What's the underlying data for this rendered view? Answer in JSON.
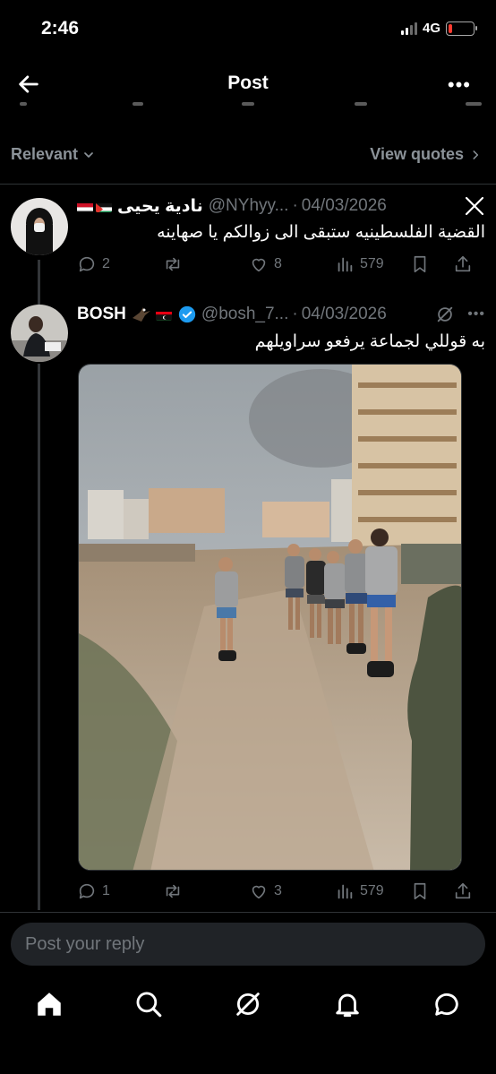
{
  "status_bar": {
    "time": "2:46",
    "network": "4G",
    "battery_level": 0.15,
    "battery_color": "#ff3b30"
  },
  "header": {
    "title": "Post",
    "back_icon": "arrow-left-icon",
    "more_icon": "more-horizontal-icon"
  },
  "sort_bar": {
    "sort_label": "Relevant",
    "view_quotes_label": "View quotes"
  },
  "tweets": [
    {
      "display_name": "نادية يحيى",
      "handle": "@NYhyy...",
      "separator": "·",
      "date": "04/03/2026",
      "text": "القضية الفلسطينيه ستبقى الى زوالكم يا صهاينه",
      "source_badge": "x-logo-icon",
      "replies": "2",
      "reposts": "",
      "likes": "8",
      "views": "579"
    },
    {
      "display_name": "BOSH",
      "handle": "@bosh_7...",
      "separator": "·",
      "date": "04/03/2026",
      "text": "به قوللي لجماعة يرفعو سراويلهم",
      "verified": true,
      "source_badge": "grok-icon",
      "replies": "1",
      "reposts": "",
      "likes": "3",
      "views": "579"
    }
  ],
  "reply_box": {
    "placeholder": "Post your reply"
  },
  "tab_bar": [
    "home-icon",
    "search-icon",
    "grok-icon",
    "notifications-bell-icon",
    "messages-icon"
  ],
  "colors": {
    "background": "#000000",
    "muted": "#71767b",
    "divider": "#2f3336",
    "verified": "#1d9bf0"
  }
}
